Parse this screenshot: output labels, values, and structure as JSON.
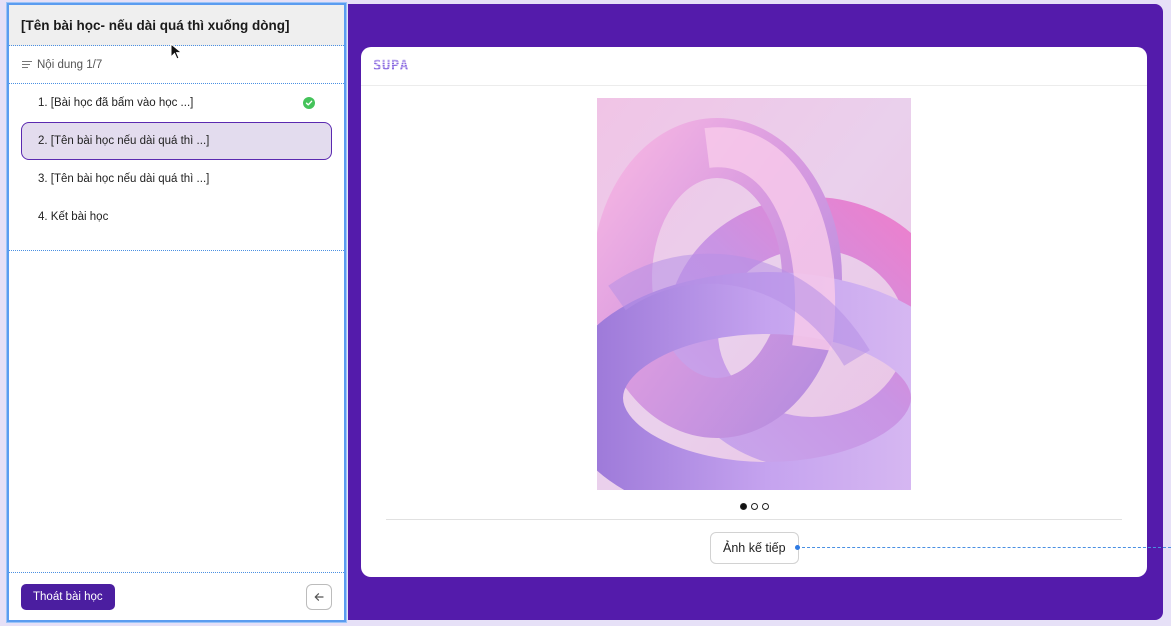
{
  "sidebar": {
    "title": "[Tên bài học- nếu dài quá thì xuống dòng]",
    "content_counter": "Nội dung 1/7",
    "items": [
      {
        "label": "1. [Bài học đã bấm vào học ...]",
        "completed": true
      },
      {
        "label": "2. [Tên bài học nếu dài quá thì ...]",
        "active": true
      },
      {
        "label": "3. [Tên bài học nếu dài quá thì ...]"
      },
      {
        "label": "4. Kết bài học"
      }
    ],
    "exit_label": "Thoát bài học",
    "back_icon": "arrow-left-icon"
  },
  "content": {
    "logo_text": "SUPA",
    "carousel": {
      "total": 3,
      "current": 1
    },
    "next_label": "Ảnh kế tiếp"
  },
  "colors": {
    "accent": "#541bab",
    "exit_button": "#4b1ea0",
    "active_item_bg": "#e3dcee",
    "active_item_border": "#5b2ab0",
    "success": "#44c35a"
  }
}
